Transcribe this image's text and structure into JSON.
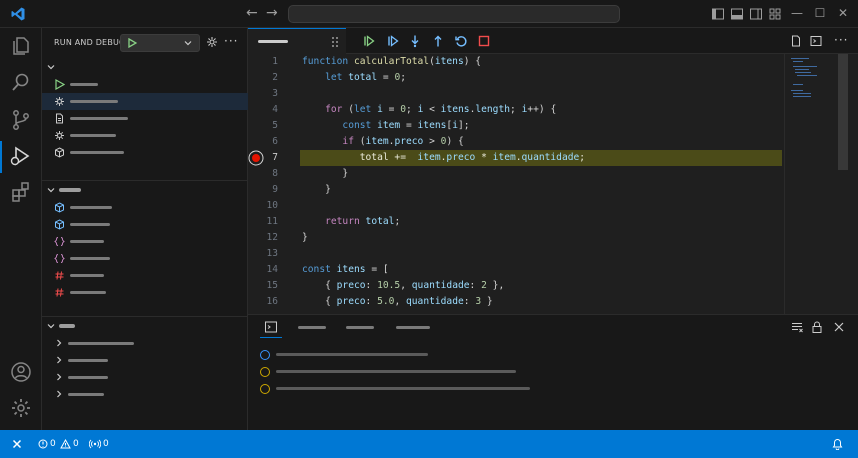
{
  "sidebar": {
    "title": "RUN AND DEBUG"
  },
  "code": {
    "line_numbers": [
      "1",
      "2",
      "3",
      "4",
      "5",
      "6",
      "7",
      "8",
      "9",
      "10",
      "11",
      "12",
      "13",
      "14",
      "15",
      "16"
    ],
    "current_line": "7",
    "lines": [
      [
        {
          "t": "function ",
          "c": "kw"
        },
        {
          "t": "calcularTotal",
          "c": "fn"
        },
        {
          "t": "(",
          "c": "pun"
        },
        {
          "t": "itens",
          "c": "var"
        },
        {
          "t": ") {",
          "c": "pun"
        }
      ],
      [
        {
          "t": "    let ",
          "c": "kw"
        },
        {
          "t": "total",
          "c": "var"
        },
        {
          "t": " = ",
          "c": "pun"
        },
        {
          "t": "0",
          "c": "num"
        },
        {
          "t": ";",
          "c": "pun"
        }
      ],
      [],
      [
        {
          "t": "    for ",
          "c": "ctl"
        },
        {
          "t": "(",
          "c": "pun"
        },
        {
          "t": "let ",
          "c": "kw"
        },
        {
          "t": "i",
          "c": "var"
        },
        {
          "t": " = ",
          "c": "pun"
        },
        {
          "t": "0",
          "c": "num"
        },
        {
          "t": "; ",
          "c": "pun"
        },
        {
          "t": "i",
          "c": "var"
        },
        {
          "t": " < ",
          "c": "pun"
        },
        {
          "t": "itens",
          "c": "var"
        },
        {
          "t": ".",
          "c": "pun"
        },
        {
          "t": "length",
          "c": "var"
        },
        {
          "t": "; ",
          "c": "pun"
        },
        {
          "t": "i",
          "c": "var"
        },
        {
          "t": "++) {",
          "c": "pun"
        }
      ],
      [
        {
          "t": "       const ",
          "c": "kw"
        },
        {
          "t": "item",
          "c": "var"
        },
        {
          "t": " = ",
          "c": "pun"
        },
        {
          "t": "itens",
          "c": "var"
        },
        {
          "t": "[",
          "c": "pun"
        },
        {
          "t": "i",
          "c": "var"
        },
        {
          "t": "];",
          "c": "pun"
        }
      ],
      [
        {
          "t": "       if ",
          "c": "ctl"
        },
        {
          "t": "(",
          "c": "pun"
        },
        {
          "t": "item",
          "c": "var"
        },
        {
          "t": ".",
          "c": "pun"
        },
        {
          "t": "preco",
          "c": "var"
        },
        {
          "t": " > ",
          "c": "pun"
        },
        {
          "t": "0",
          "c": "num"
        },
        {
          "t": ") {",
          "c": "pun"
        }
      ],
      [
        {
          "t": "          total += ",
          "c": "hlt"
        },
        {
          "t": " item",
          "c": "var"
        },
        {
          "t": ".",
          "c": "hlt"
        },
        {
          "t": "preco",
          "c": "var"
        },
        {
          "t": " * ",
          "c": "hlt"
        },
        {
          "t": "item",
          "c": "var"
        },
        {
          "t": ".",
          "c": "hlt"
        },
        {
          "t": "quantidade",
          "c": "var"
        },
        {
          "t": ";",
          "c": "hlt"
        }
      ],
      [
        {
          "t": "       }",
          "c": "pun"
        }
      ],
      [
        {
          "t": "    }",
          "c": "pun"
        }
      ],
      [],
      [
        {
          "t": "    return ",
          "c": "ctl"
        },
        {
          "t": "total",
          "c": "var"
        },
        {
          "t": ";",
          "c": "pun"
        }
      ],
      [
        {
          "t": "}",
          "c": "pun"
        }
      ],
      [],
      [
        {
          "t": "const ",
          "c": "kw"
        },
        {
          "t": "itens",
          "c": "var"
        },
        {
          "t": " = [",
          "c": "pun"
        }
      ],
      [
        {
          "t": "    { ",
          "c": "pun"
        },
        {
          "t": "preco",
          "c": "var"
        },
        {
          "t": ": ",
          "c": "pun"
        },
        {
          "t": "10.5",
          "c": "num"
        },
        {
          "t": ", ",
          "c": "pun"
        },
        {
          "t": "quantidade",
          "c": "var"
        },
        {
          "t": ": ",
          "c": "pun"
        },
        {
          "t": "2",
          "c": "num"
        },
        {
          "t": " },",
          "c": "pun"
        }
      ],
      [
        {
          "t": "    { ",
          "c": "pun"
        },
        {
          "t": "preco",
          "c": "var"
        },
        {
          "t": ": ",
          "c": "pun"
        },
        {
          "t": "5.0",
          "c": "num"
        },
        {
          "t": ", ",
          "c": "pun"
        },
        {
          "t": "quantidade",
          "c": "var"
        },
        {
          "t": ": ",
          "c": "pun"
        },
        {
          "t": "3",
          "c": "num"
        },
        {
          "t": " }",
          "c": "pun"
        }
      ]
    ]
  },
  "statusbar": {
    "errors": "0",
    "warnings": "0",
    "ports": "0"
  },
  "colors": {
    "accent": "#0078d4",
    "status_bar": "#0078d4",
    "breakpoint": "#e51400",
    "current_line": "#4b4b18"
  }
}
